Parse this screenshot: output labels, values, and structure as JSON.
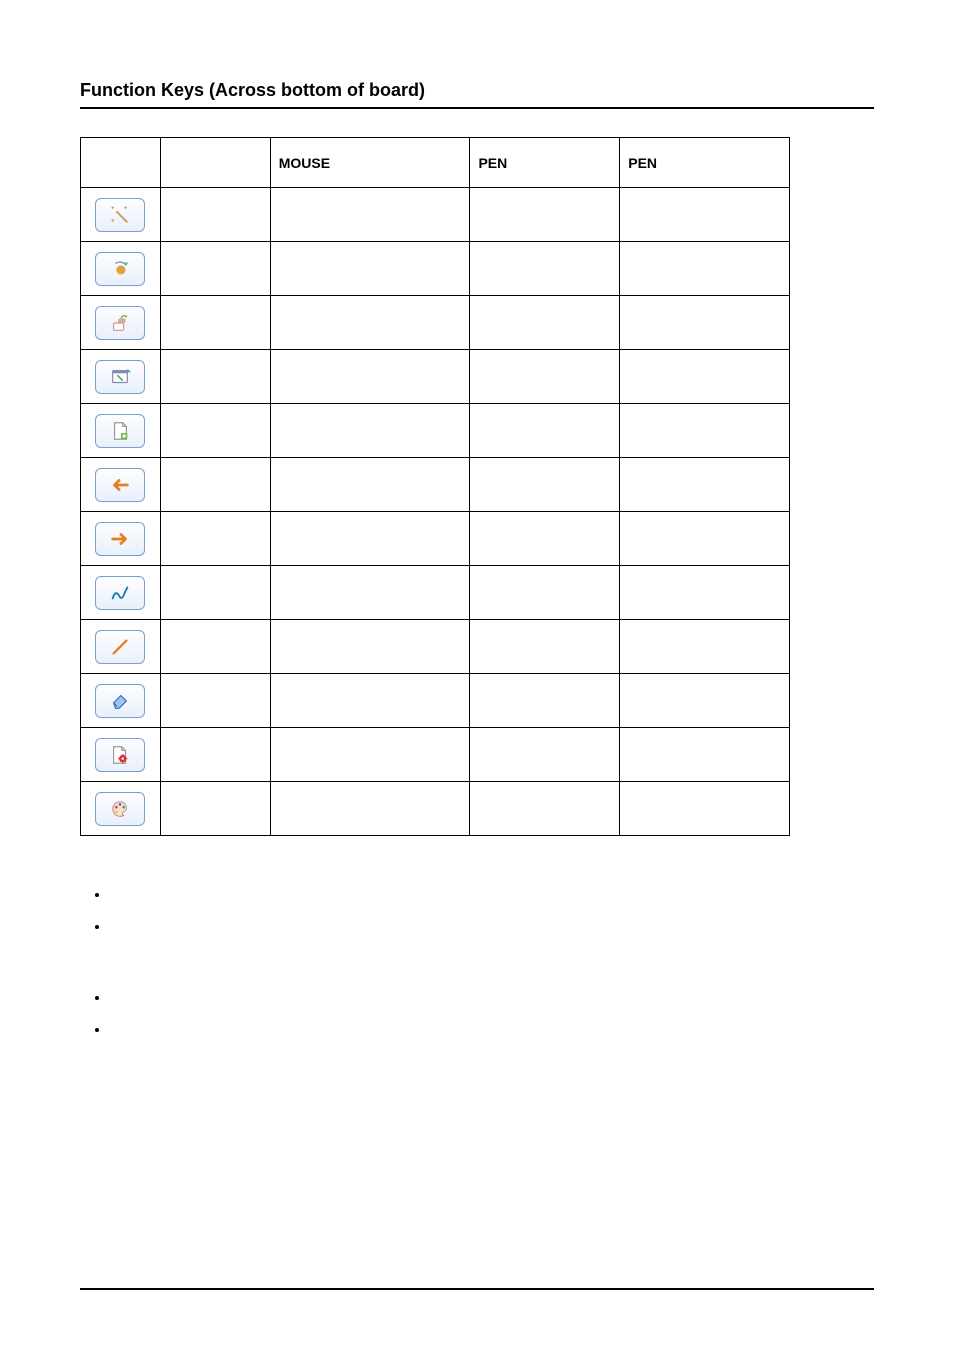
{
  "heading": "Function Keys (Across bottom of board)",
  "columns": {
    "c1": "",
    "c2": "",
    "c3": "MOUSE",
    "c4": "PEN",
    "c5": "PEN"
  },
  "rows": [
    {
      "iconName": "calibrate-icon"
    },
    {
      "iconName": "orbit-icon"
    },
    {
      "iconName": "hand-icon"
    },
    {
      "iconName": "window-draw-icon"
    },
    {
      "iconName": "new-page-icon"
    },
    {
      "iconName": "arrow-left-icon"
    },
    {
      "iconName": "arrow-right-icon"
    },
    {
      "iconName": "freehand-icon"
    },
    {
      "iconName": "line-icon"
    },
    {
      "iconName": "eraser-icon"
    },
    {
      "iconName": "page-settings-icon"
    },
    {
      "iconName": "palette-icon"
    }
  ],
  "notes": {
    "heading1": "",
    "items1": [
      "",
      ""
    ],
    "heading2": "",
    "items2": [
      "",
      ""
    ]
  }
}
